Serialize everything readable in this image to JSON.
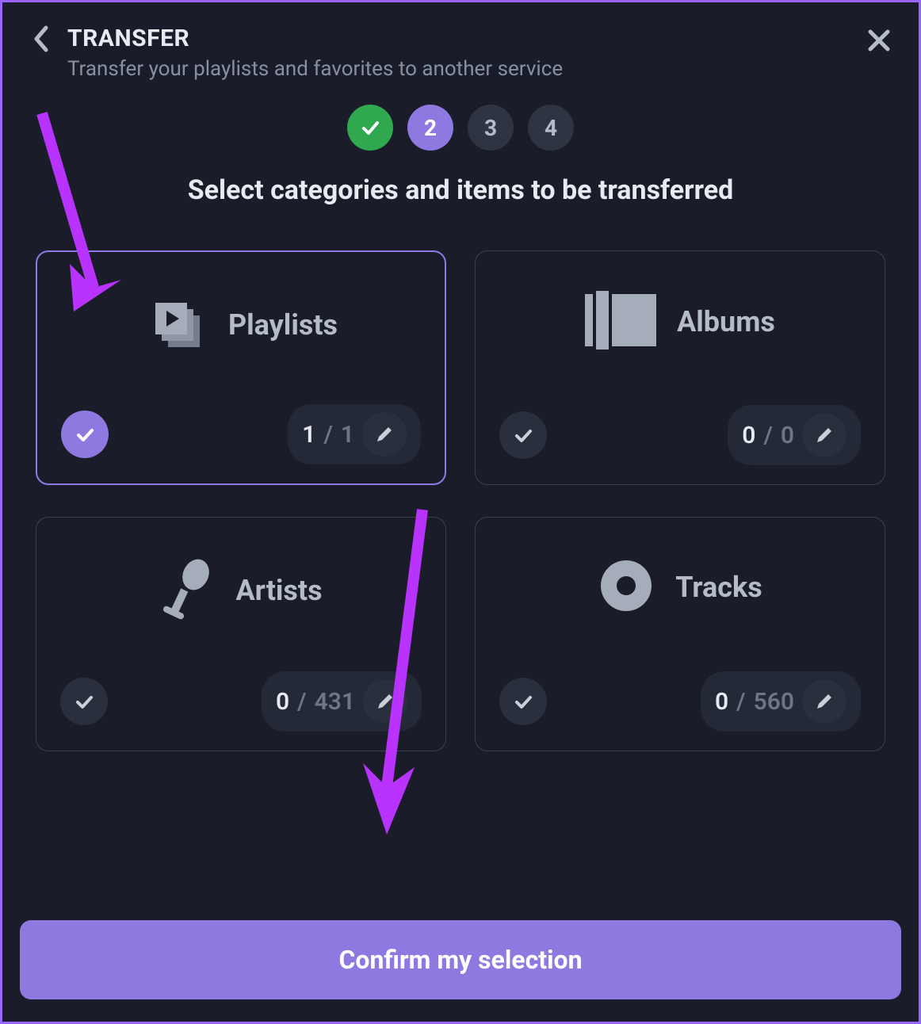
{
  "header": {
    "title": "TRANSFER",
    "subtitle": "Transfer your playlists and favorites to another service"
  },
  "steps": [
    "✓",
    "2",
    "3",
    "4"
  ],
  "section_title": "Select categories and items to be transferred",
  "cards": [
    {
      "key": "playlists",
      "label": "Playlists",
      "selected": 1,
      "total": 1,
      "checked": true,
      "highlighted": true
    },
    {
      "key": "albums",
      "label": "Albums",
      "selected": 0,
      "total": 0,
      "checked": false,
      "highlighted": false
    },
    {
      "key": "artists",
      "label": "Artists",
      "selected": 0,
      "total": 431,
      "checked": false,
      "highlighted": false
    },
    {
      "key": "tracks",
      "label": "Tracks",
      "selected": 0,
      "total": 560,
      "checked": false,
      "highlighted": false
    }
  ],
  "confirm_label": "Confirm my selection",
  "count_separator": "/"
}
